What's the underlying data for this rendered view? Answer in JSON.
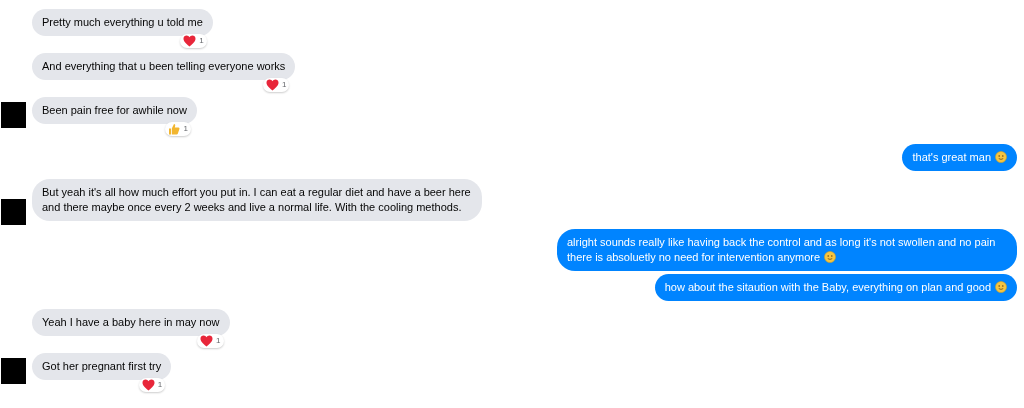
{
  "messages": [
    {
      "kind": "incoming",
      "text": "Pretty much everything u told me",
      "avatar": false,
      "reaction": {
        "kind": "heart",
        "count": "1"
      }
    },
    {
      "kind": "incoming",
      "text": "And everything that u been telling  everyone works",
      "avatar": false,
      "reaction": {
        "kind": "heart",
        "count": "1"
      }
    },
    {
      "kind": "incoming",
      "text": "Been pain free for awhile now",
      "avatar": true,
      "reaction": {
        "kind": "thumb",
        "count": "1"
      }
    },
    {
      "kind": "outgoing",
      "text": "that's great man",
      "smiley": true
    },
    {
      "kind": "incoming",
      "text": "But yeah it's all how much effort you put in. I can eat a regular diet and have a beer here and there maybe once every 2 weeks and live a normal life. With the cooling methods.",
      "avatar": true
    },
    {
      "kind": "outgoing",
      "text": "alright sounds really like having back the control and as long it's not swollen and no pain there is absoluetly no need for intervention anymore",
      "smiley": true
    },
    {
      "kind": "outgoing",
      "text": "how about the sitaution with the Baby, everything on plan and good",
      "smiley": true
    },
    {
      "kind": "incoming",
      "text": "Yeah I have a baby here in may now",
      "avatar": false,
      "reaction": {
        "kind": "heart",
        "count": "1"
      }
    },
    {
      "kind": "incoming",
      "text": "Got her pregnant first try",
      "avatar": true,
      "reaction": {
        "kind": "heart",
        "count": "1"
      }
    }
  ]
}
